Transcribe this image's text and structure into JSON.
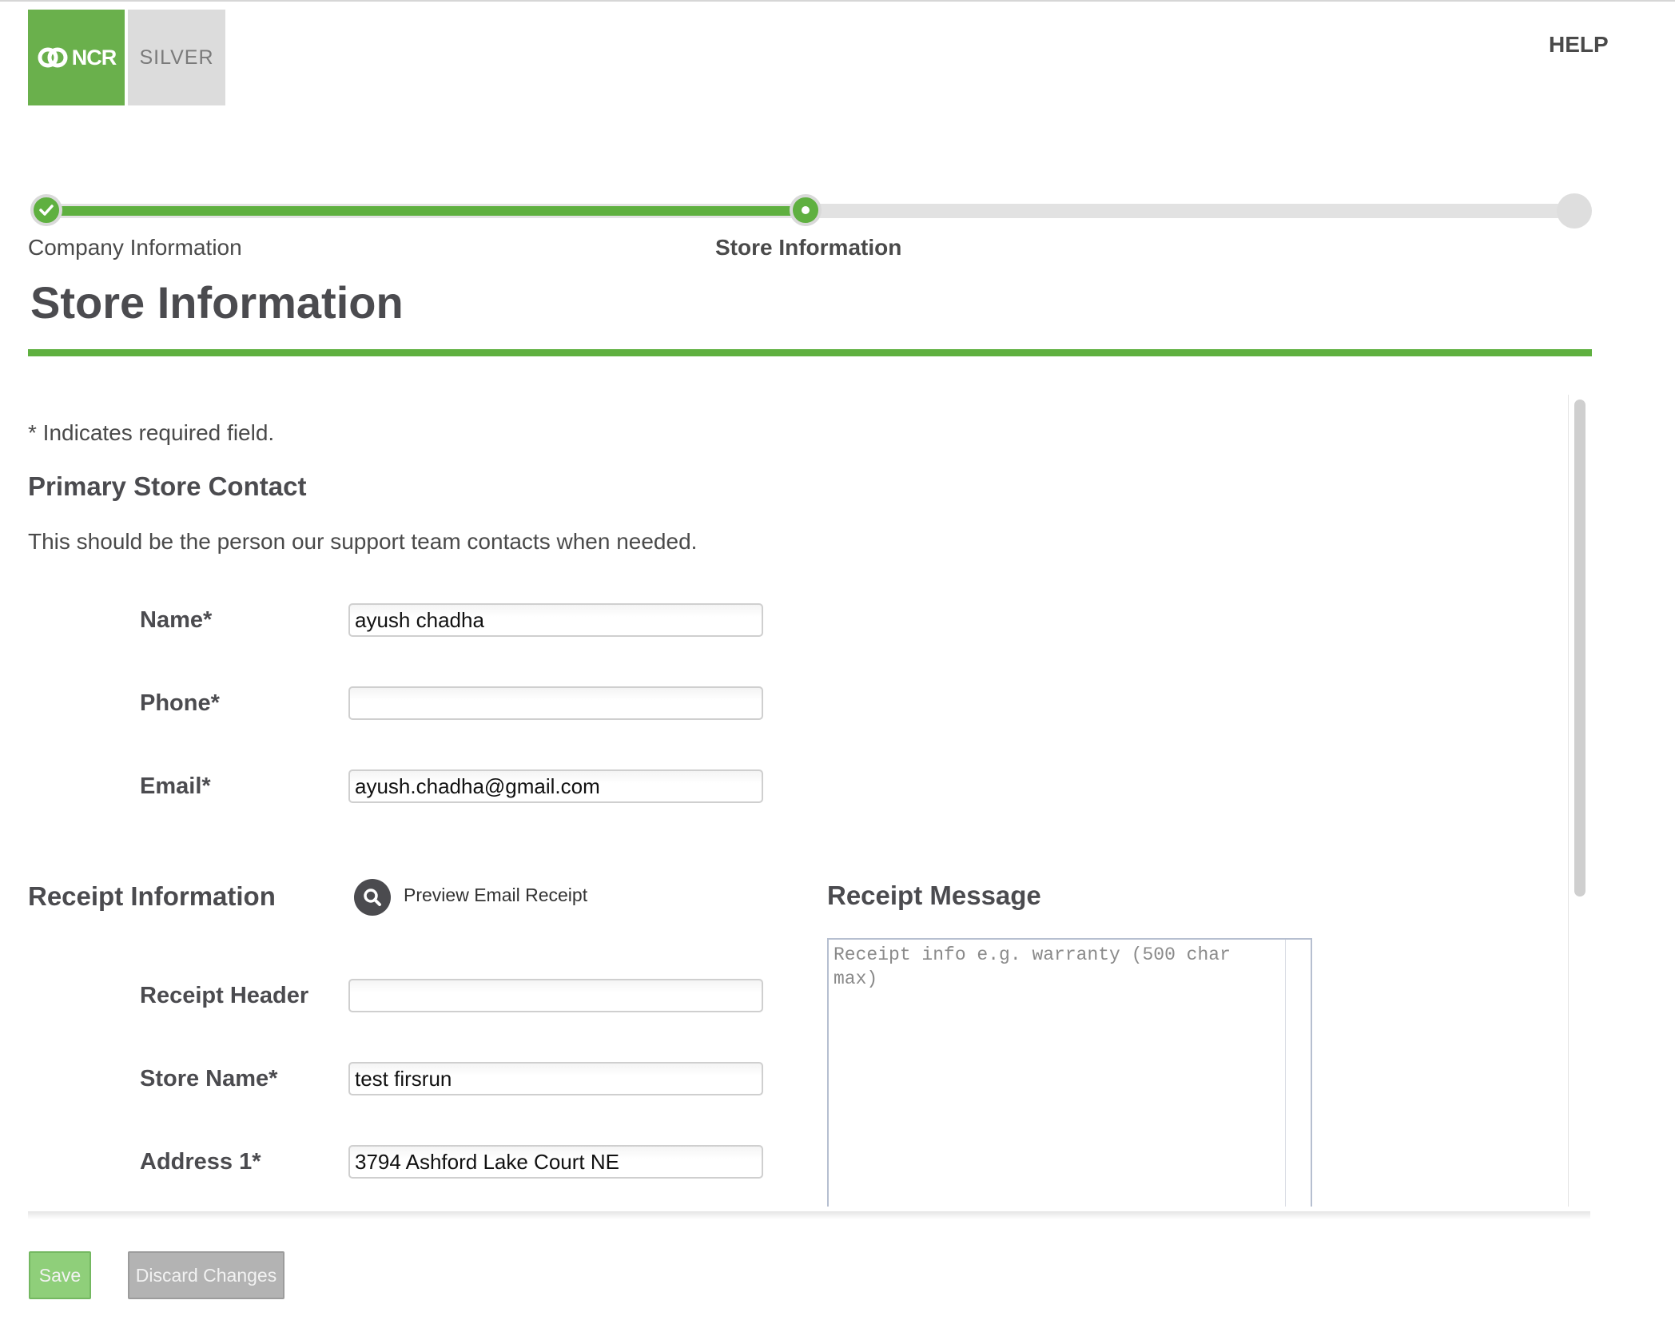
{
  "header": {
    "logo_brand": "NCR",
    "logo_product": "SILVER",
    "help_label": "HELP"
  },
  "progress": {
    "steps": [
      {
        "label": "Company Information",
        "status": "complete"
      },
      {
        "label": "Store Information",
        "status": "current"
      },
      {
        "label": "",
        "status": "upcoming"
      }
    ]
  },
  "page": {
    "title": "Store Information",
    "required_note": "* Indicates required field."
  },
  "contact": {
    "heading": "Primary Store Contact",
    "description": "This should be the person our support team contacts when needed.",
    "name_label": "Name*",
    "name_value": "ayush chadha",
    "phone_label": "Phone*",
    "phone_value": "",
    "email_label": "Email*",
    "email_value": "ayush.chadha@gmail.com"
  },
  "receipt": {
    "heading": "Receipt Information",
    "preview_label": "Preview Email Receipt",
    "header_label": "Receipt Header",
    "header_value": "",
    "store_name_label": "Store Name*",
    "store_name_value": "test firsrun",
    "address1_label": "Address 1*",
    "address1_value": "3794 Ashford Lake Court NE",
    "message_heading": "Receipt Message",
    "message_placeholder": "Receipt info e.g. warranty (500 char max)"
  },
  "footer": {
    "save_label": "Save",
    "discard_label": "Discard Changes"
  },
  "colors": {
    "accent": "#5fb040",
    "text": "#4b4b4f",
    "disabled_save": "#8fcf7a",
    "disabled_discard": "#b3b3b3"
  }
}
